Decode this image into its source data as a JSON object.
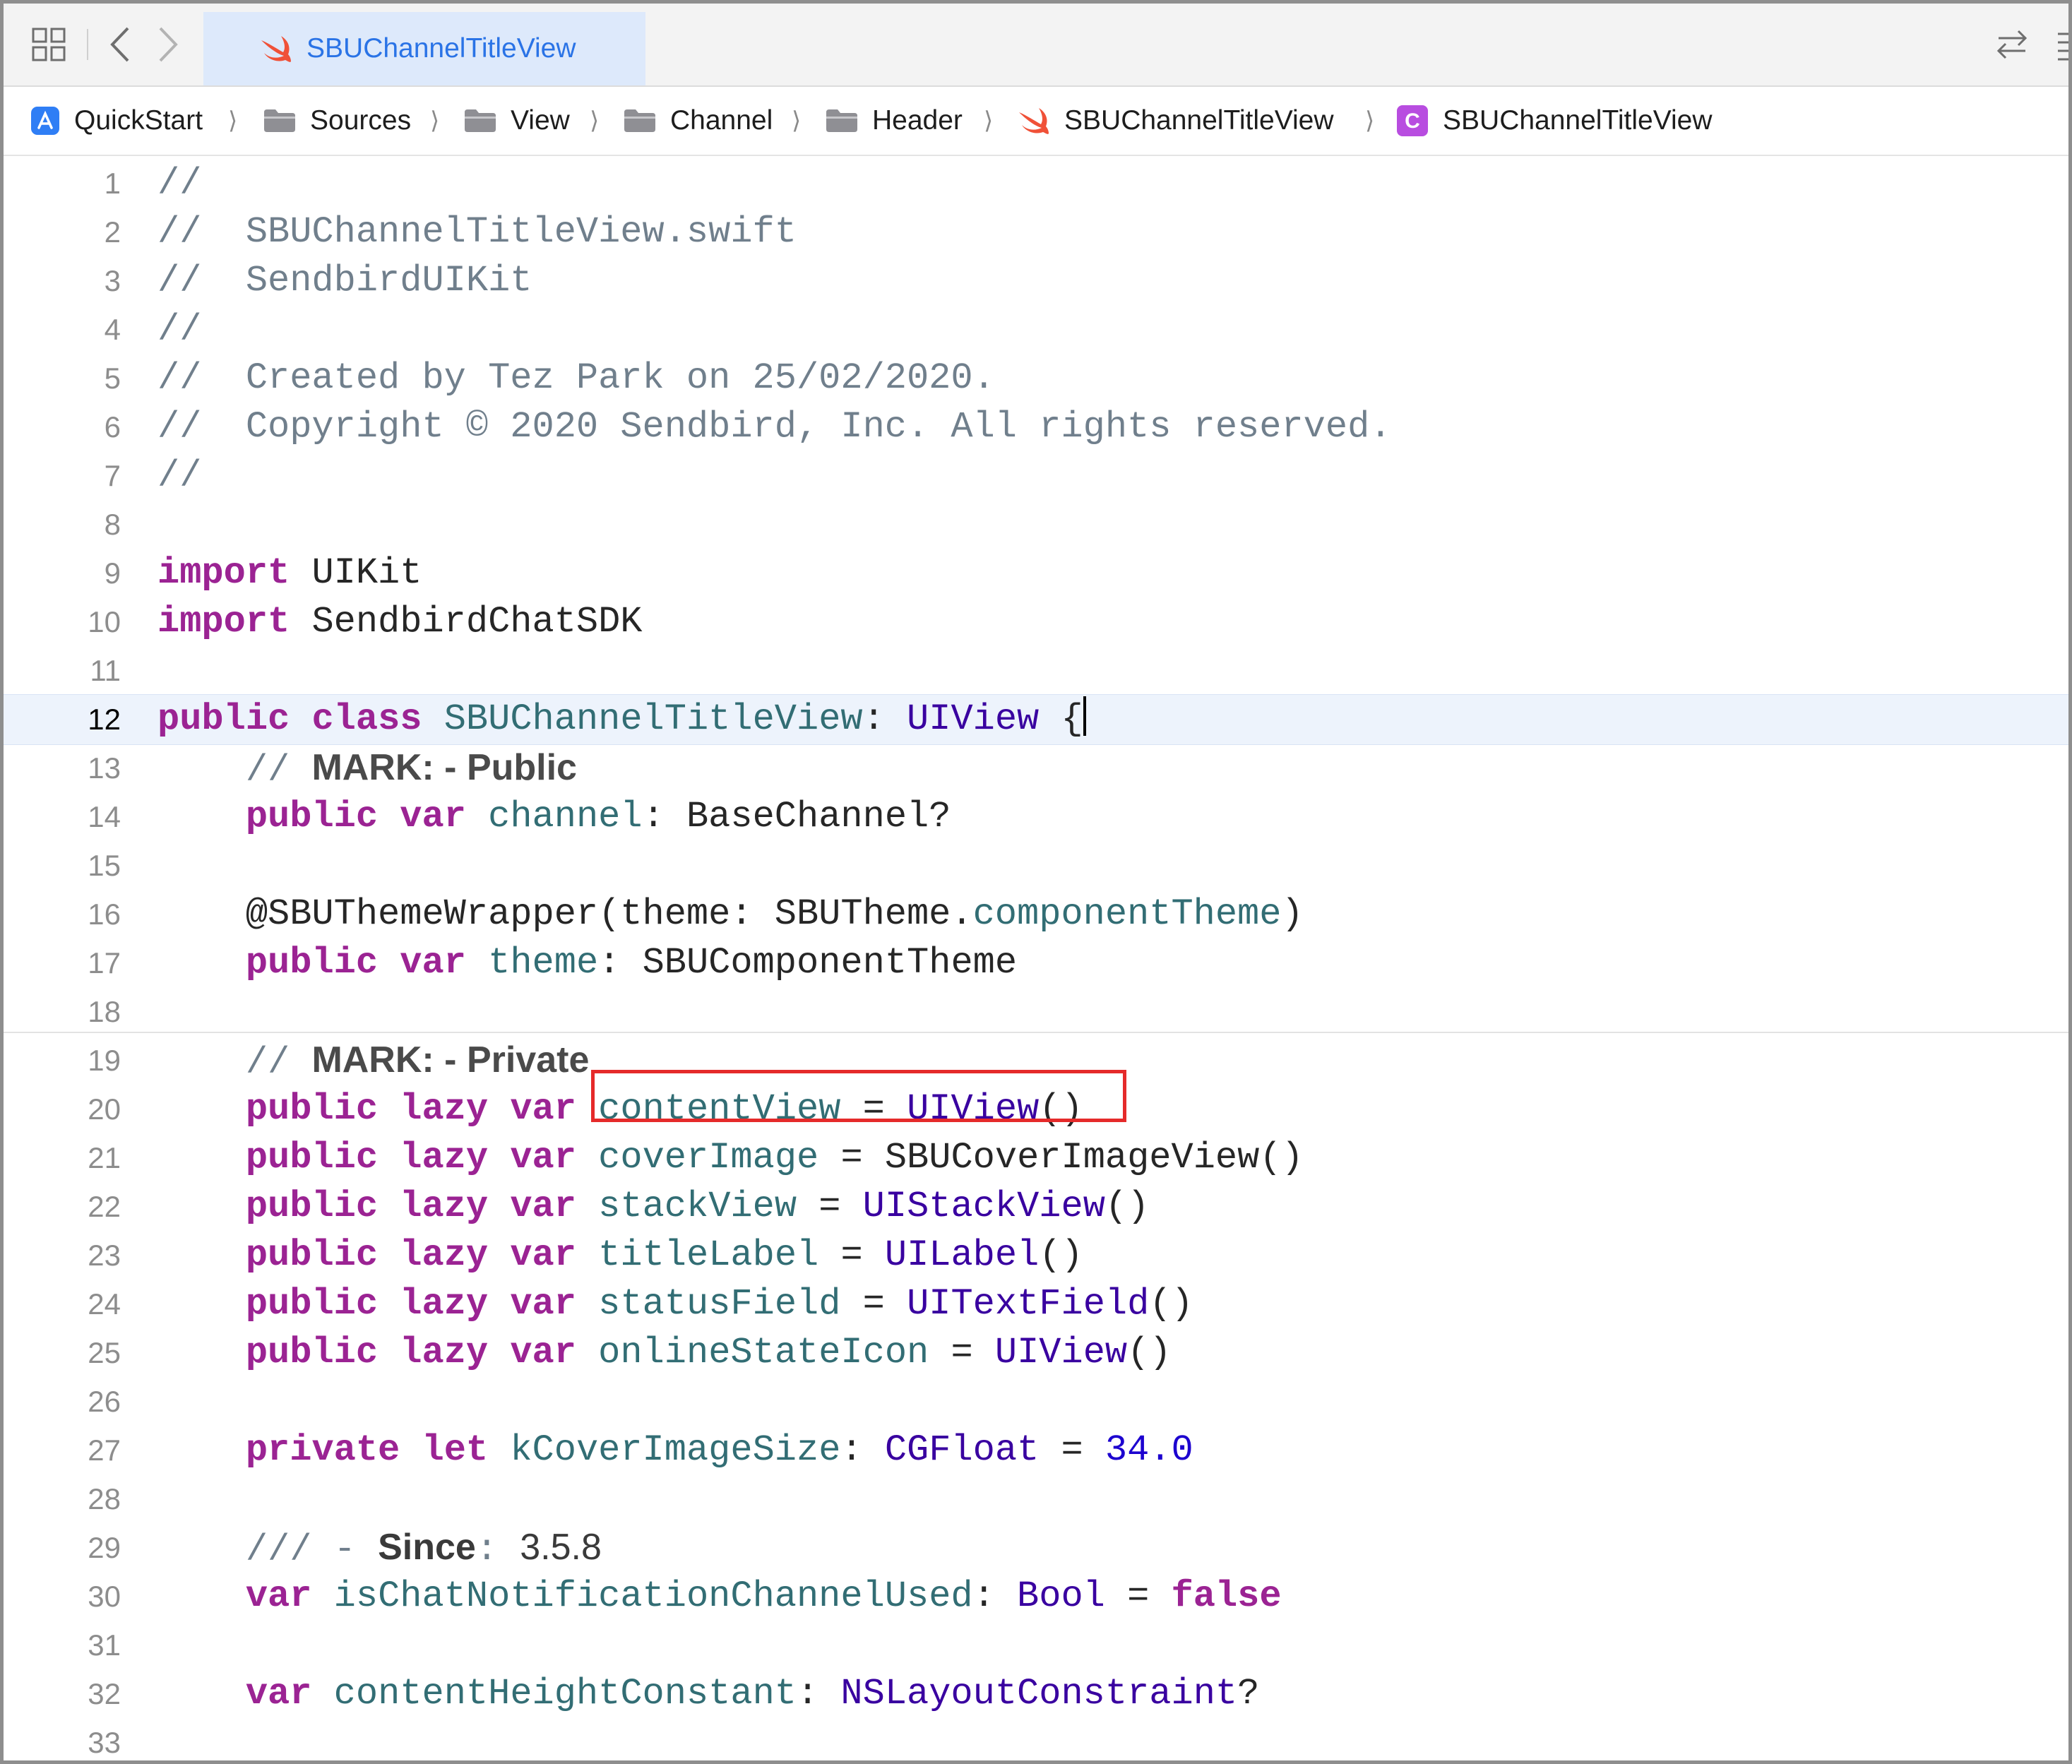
{
  "tabbar": {
    "active_tab": "SBUChannelTitleView"
  },
  "breadcrumb": {
    "items": [
      "QuickStart",
      "Sources",
      "View",
      "Channel",
      "Header",
      "SBUChannelTitleView",
      "SBUChannelTitleView"
    ],
    "class_badge": "C",
    "separator": "⟩"
  },
  "editor": {
    "active_line": 12,
    "line_numbers": [
      "1",
      "2",
      "3",
      "4",
      "5",
      "6",
      "7",
      "8",
      "9",
      "10",
      "11",
      "12",
      "13",
      "14",
      "15",
      "16",
      "17",
      "18",
      "19",
      "20",
      "21",
      "22",
      "23",
      "24",
      "25",
      "26",
      "27",
      "28",
      "29",
      "30",
      "31",
      "32",
      "33"
    ],
    "highlighted_code": "titleLabel = UILabel()",
    "lines": [
      [
        {
          "t": "//",
          "c": "cm"
        }
      ],
      [
        {
          "t": "//  SBUChannelTitleView.swift",
          "c": "cm"
        }
      ],
      [
        {
          "t": "//  SendbirdUIKit",
          "c": "cm"
        }
      ],
      [
        {
          "t": "//",
          "c": "cm"
        }
      ],
      [
        {
          "t": "//  Created by Tez Park on 25/02/2020.",
          "c": "cm"
        }
      ],
      [
        {
          "t": "//  Copyright © 2020 Sendbird, Inc. All rights reserved.",
          "c": "cm"
        }
      ],
      [
        {
          "t": "//",
          "c": "cm"
        }
      ],
      [],
      [
        {
          "t": "import",
          "c": "kw"
        },
        {
          "t": " UIKit",
          "c": "pl"
        }
      ],
      [
        {
          "t": "import",
          "c": "kw"
        },
        {
          "t": " SendbirdChatSDK",
          "c": "pl"
        }
      ],
      [],
      [
        {
          "t": "public",
          "c": "kw"
        },
        {
          "t": " ",
          "c": "pl"
        },
        {
          "t": "class",
          "c": "kw"
        },
        {
          "t": " ",
          "c": "pl"
        },
        {
          "t": "SBUChannelTitleView",
          "c": "id"
        },
        {
          "t": ": ",
          "c": "pl"
        },
        {
          "t": "UIView",
          "c": "ty"
        },
        {
          "t": " {",
          "c": "pl"
        },
        {
          "caret": true
        }
      ],
      [
        {
          "t": "    // ",
          "c": "cm"
        },
        {
          "t": "MARK: - Public",
          "c": "mk"
        }
      ],
      [
        {
          "t": "    ",
          "c": "pl"
        },
        {
          "t": "public",
          "c": "kw"
        },
        {
          "t": " ",
          "c": "pl"
        },
        {
          "t": "var",
          "c": "kw"
        },
        {
          "t": " ",
          "c": "pl"
        },
        {
          "t": "channel",
          "c": "id"
        },
        {
          "t": ": BaseChannel?",
          "c": "pl"
        }
      ],
      [],
      [
        {
          "t": "    @SBUThemeWrapper(theme: SBUTheme.",
          "c": "pl"
        },
        {
          "t": "componentTheme",
          "c": "id"
        },
        {
          "t": ")",
          "c": "pl"
        }
      ],
      [
        {
          "t": "    ",
          "c": "pl"
        },
        {
          "t": "public",
          "c": "kw"
        },
        {
          "t": " ",
          "c": "pl"
        },
        {
          "t": "var",
          "c": "kw"
        },
        {
          "t": " ",
          "c": "pl"
        },
        {
          "t": "theme",
          "c": "id"
        },
        {
          "t": ": SBUComponentTheme",
          "c": "pl"
        }
      ],
      [],
      [
        {
          "t": "    // ",
          "c": "cm"
        },
        {
          "t": "MARK: - Private",
          "c": "mk"
        }
      ],
      [
        {
          "t": "    ",
          "c": "pl"
        },
        {
          "t": "public",
          "c": "kw"
        },
        {
          "t": " ",
          "c": "pl"
        },
        {
          "t": "lazy",
          "c": "kw"
        },
        {
          "t": " ",
          "c": "pl"
        },
        {
          "t": "var",
          "c": "kw"
        },
        {
          "t": " ",
          "c": "pl"
        },
        {
          "t": "contentView",
          "c": "id"
        },
        {
          "t": " = ",
          "c": "pl"
        },
        {
          "t": "UIView",
          "c": "ty"
        },
        {
          "t": "()",
          "c": "pl"
        }
      ],
      [
        {
          "t": "    ",
          "c": "pl"
        },
        {
          "t": "public",
          "c": "kw"
        },
        {
          "t": " ",
          "c": "pl"
        },
        {
          "t": "lazy",
          "c": "kw"
        },
        {
          "t": " ",
          "c": "pl"
        },
        {
          "t": "var",
          "c": "kw"
        },
        {
          "t": " ",
          "c": "pl"
        },
        {
          "t": "coverImage",
          "c": "id"
        },
        {
          "t": " = SBUCoverImageView()",
          "c": "pl"
        }
      ],
      [
        {
          "t": "    ",
          "c": "pl"
        },
        {
          "t": "public",
          "c": "kw"
        },
        {
          "t": " ",
          "c": "pl"
        },
        {
          "t": "lazy",
          "c": "kw"
        },
        {
          "t": " ",
          "c": "pl"
        },
        {
          "t": "var",
          "c": "kw"
        },
        {
          "t": " ",
          "c": "pl"
        },
        {
          "t": "stackView",
          "c": "id"
        },
        {
          "t": " = ",
          "c": "pl"
        },
        {
          "t": "UIStackView",
          "c": "ty"
        },
        {
          "t": "()",
          "c": "pl"
        }
      ],
      [
        {
          "t": "    ",
          "c": "pl"
        },
        {
          "t": "public",
          "c": "kw"
        },
        {
          "t": " ",
          "c": "pl"
        },
        {
          "t": "lazy",
          "c": "kw"
        },
        {
          "t": " ",
          "c": "pl"
        },
        {
          "t": "var",
          "c": "kw"
        },
        {
          "t": " ",
          "c": "pl"
        },
        {
          "t": "titleLabel",
          "c": "id"
        },
        {
          "t": " = ",
          "c": "pl"
        },
        {
          "t": "UILabel",
          "c": "ty"
        },
        {
          "t": "()",
          "c": "pl"
        }
      ],
      [
        {
          "t": "    ",
          "c": "pl"
        },
        {
          "t": "public",
          "c": "kw"
        },
        {
          "t": " ",
          "c": "pl"
        },
        {
          "t": "lazy",
          "c": "kw"
        },
        {
          "t": " ",
          "c": "pl"
        },
        {
          "t": "var",
          "c": "kw"
        },
        {
          "t": " ",
          "c": "pl"
        },
        {
          "t": "statusField",
          "c": "id"
        },
        {
          "t": " = ",
          "c": "pl"
        },
        {
          "t": "UITextField",
          "c": "ty"
        },
        {
          "t": "()",
          "c": "pl"
        }
      ],
      [
        {
          "t": "    ",
          "c": "pl"
        },
        {
          "t": "public",
          "c": "kw"
        },
        {
          "t": " ",
          "c": "pl"
        },
        {
          "t": "lazy",
          "c": "kw"
        },
        {
          "t": " ",
          "c": "pl"
        },
        {
          "t": "var",
          "c": "kw"
        },
        {
          "t": " ",
          "c": "pl"
        },
        {
          "t": "onlineStateIcon",
          "c": "id"
        },
        {
          "t": " = ",
          "c": "pl"
        },
        {
          "t": "UIView",
          "c": "ty"
        },
        {
          "t": "()",
          "c": "pl"
        }
      ],
      [],
      [
        {
          "t": "    ",
          "c": "pl"
        },
        {
          "t": "private",
          "c": "kw"
        },
        {
          "t": " ",
          "c": "pl"
        },
        {
          "t": "let",
          "c": "kw"
        },
        {
          "t": " ",
          "c": "pl"
        },
        {
          "t": "kCoverImageSize",
          "c": "id"
        },
        {
          "t": ": ",
          "c": "pl"
        },
        {
          "t": "CGFloat",
          "c": "ty"
        },
        {
          "t": " = ",
          "c": "pl"
        },
        {
          "t": "34.0",
          "c": "nm"
        }
      ],
      [],
      [
        {
          "t": "    /// - ",
          "c": "dc"
        },
        {
          "t": "Since",
          "c": "ds"
        },
        {
          "t": ": ",
          "c": "dc"
        },
        {
          "t": "3.5.8",
          "c": "dv"
        }
      ],
      [
        {
          "t": "    ",
          "c": "pl"
        },
        {
          "t": "var",
          "c": "kw"
        },
        {
          "t": " ",
          "c": "pl"
        },
        {
          "t": "isChatNotificationChannelUsed",
          "c": "id"
        },
        {
          "t": ": ",
          "c": "pl"
        },
        {
          "t": "Bool",
          "c": "ty"
        },
        {
          "t": " = ",
          "c": "pl"
        },
        {
          "t": "false",
          "c": "kw"
        }
      ],
      [],
      [
        {
          "t": "    ",
          "c": "pl"
        },
        {
          "t": "var",
          "c": "kw"
        },
        {
          "t": " ",
          "c": "pl"
        },
        {
          "t": "contentHeightConstant",
          "c": "id"
        },
        {
          "t": ": ",
          "c": "pl"
        },
        {
          "t": "NSLayoutConstraint",
          "c": "ty"
        },
        {
          "t": "?",
          "c": "pl"
        }
      ],
      []
    ]
  },
  "colors": {
    "keyword": "#9b2393",
    "type": "#3900a0",
    "identifier": "#326d74",
    "comment": "#707f8c",
    "number": "#1c00cf",
    "tab_active_bg": "#dde9fb",
    "tab_active_text": "#2a73e6",
    "annotation_box": "#e52a2a"
  }
}
